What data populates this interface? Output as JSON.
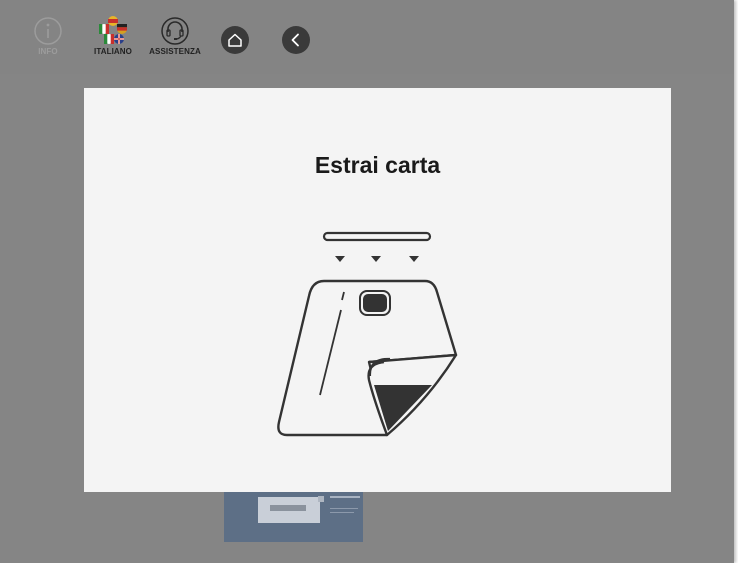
{
  "toolbar": {
    "info_label": "INFO",
    "language_label": "ITALIANO",
    "support_label": "ASSISTENZA"
  },
  "icons": {
    "info": "info-icon",
    "language": "flags-icon",
    "support": "headset-icon",
    "home": "home-icon",
    "back": "back-chevron-icon"
  },
  "modal": {
    "title": "Estrai carta"
  },
  "colors": {
    "overlay": "#858585",
    "modal_bg": "#f4f4f4",
    "icon_dark": "#3a3a3a"
  }
}
